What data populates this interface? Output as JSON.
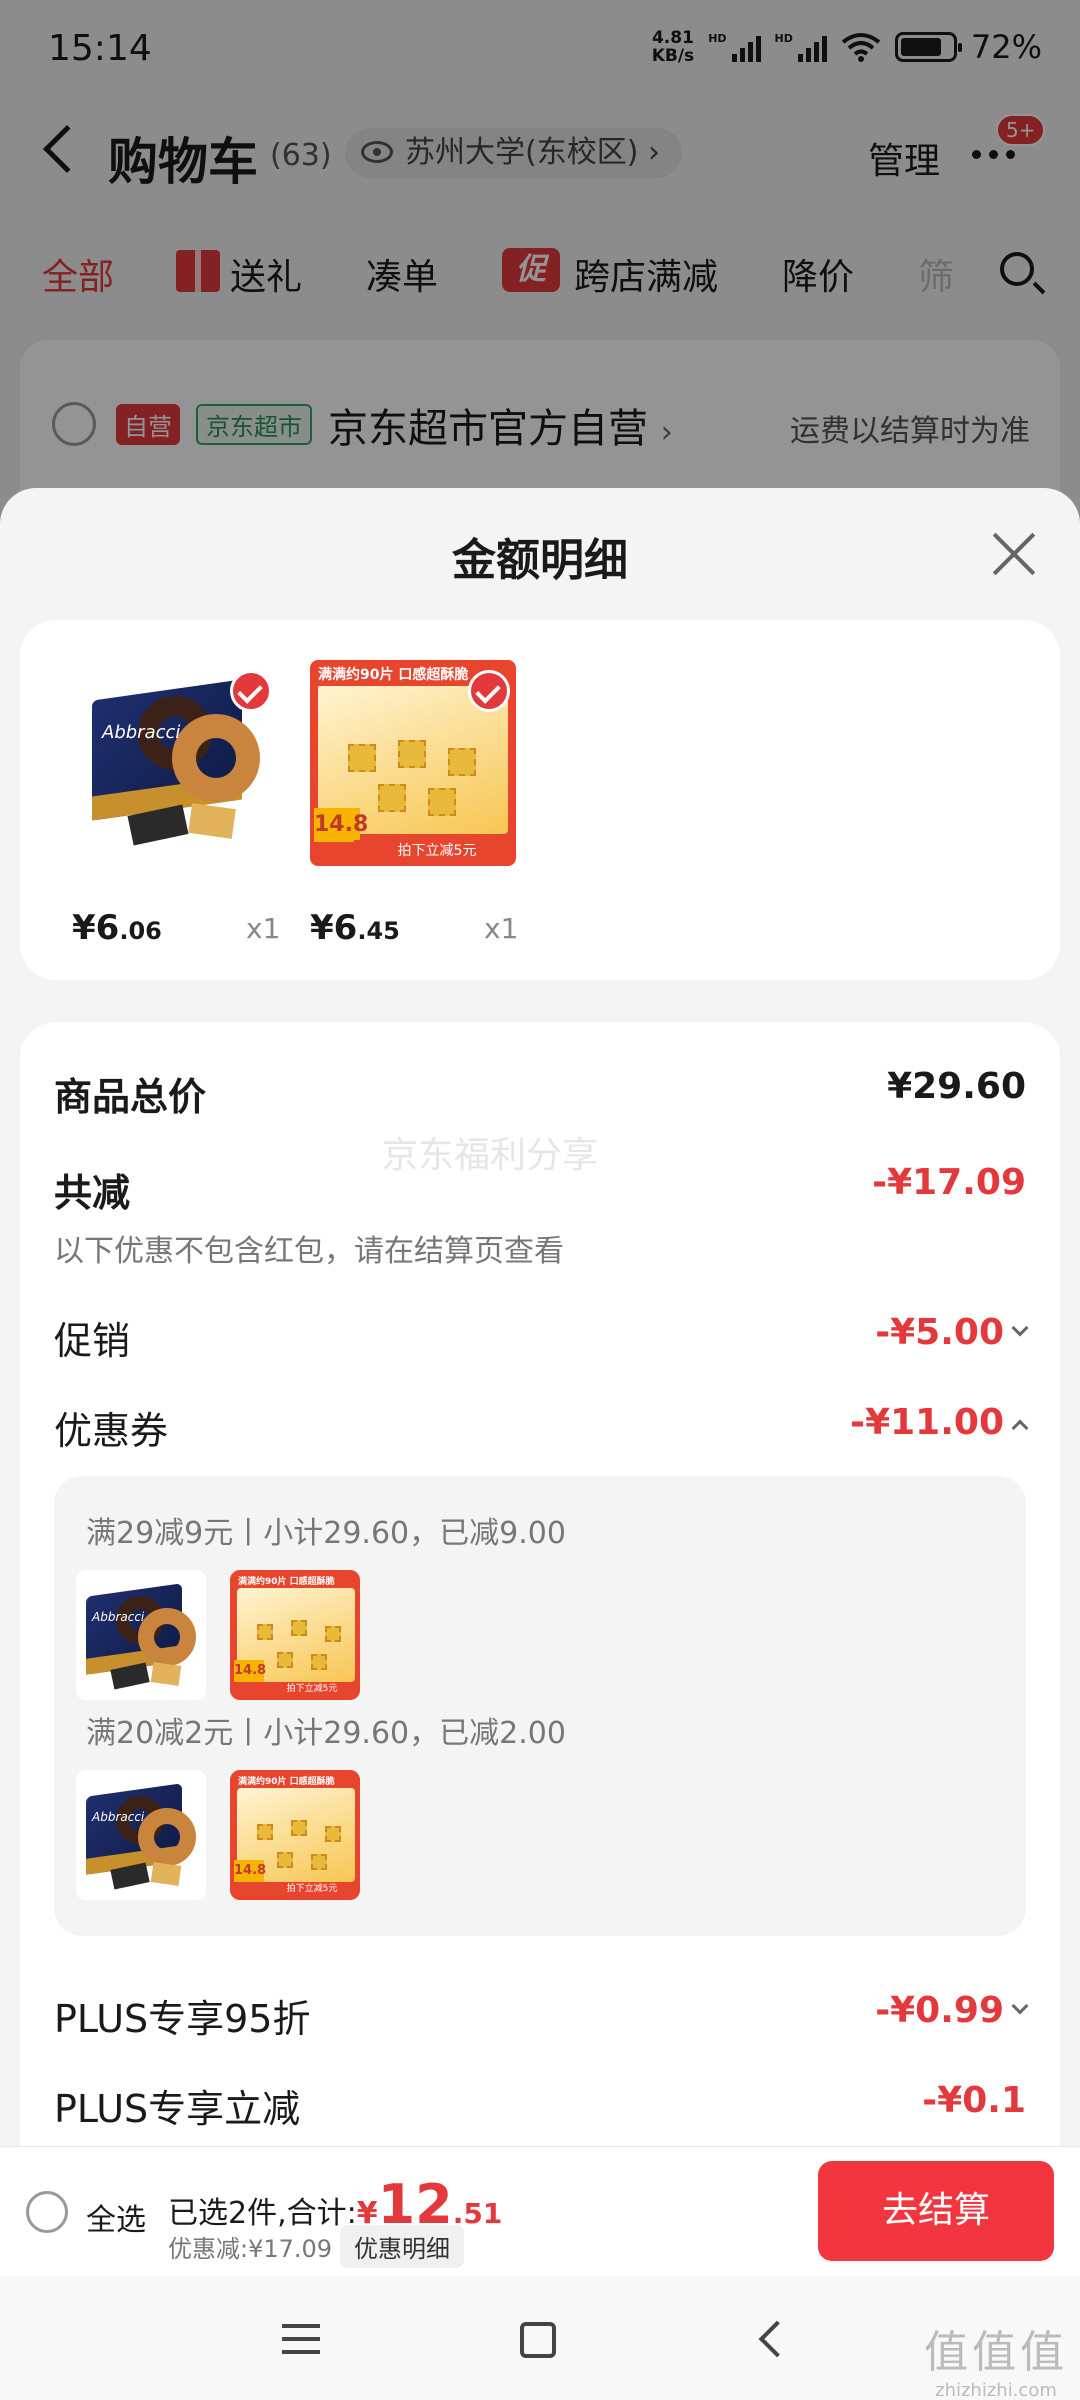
{
  "status_bar": {
    "time": "15:14",
    "net_speed_value": "4.81",
    "net_speed_unit": "KB/s",
    "signal_tag": "HD",
    "battery": "72%"
  },
  "header": {
    "title": "购物车",
    "count": "(63)",
    "location": "苏州大学(东校区)",
    "location_chevron": "›",
    "manage": "管理",
    "badge": "5+"
  },
  "tabs": {
    "all": "全部",
    "gift": "送礼",
    "bundle": "凑单",
    "promo_icon": "促",
    "cross_store": "跨店满减",
    "price_drop": "降价",
    "more": "筛"
  },
  "store": {
    "tag_self": "自营",
    "tag_market": "京东超市",
    "name": "京东超市官方自营",
    "chevron": "›",
    "shipping_note": "运费以结算时为准"
  },
  "sheet": {
    "title": "金额明细",
    "products": [
      {
        "currency": "¥",
        "price_int": "6",
        "price_dec": ".06",
        "qty": "x1"
      },
      {
        "currency": "¥",
        "price_int": "6",
        "price_dec": ".45",
        "qty": "x1"
      }
    ],
    "product_art": {
      "donut_brand": "Abbracci",
      "cracker_header": "满满约90片 口感超酥脆",
      "cracker_price": "14.8",
      "cracker_footer": "拍下立减5元"
    },
    "watermark": "京东福利分享",
    "total_label": "商品总价",
    "total_value": "¥29.60",
    "discount_label": "共减",
    "discount_value": "-¥17.09",
    "discount_note": "以下优惠不包含红包，请在结算页查看",
    "promo_label": "促销",
    "promo_value": "-¥5.00",
    "coupon_label": "优惠券",
    "coupon_value": "-¥11.00",
    "coupons": [
      {
        "text": "满29减9元丨小计29.60，已减9.00"
      },
      {
        "text": "满20减2元丨小计29.60，已减2.00"
      }
    ],
    "plus_discount_label": "PLUS专享95折",
    "plus_discount_value": "-¥0.99",
    "plus_cut_label": "PLUS专享立减",
    "plus_cut_value": "-¥0.1"
  },
  "bottom_bar": {
    "select_all": "全选",
    "selected_text": "已选2件,合计:",
    "total_currency": "¥",
    "total_int": "12",
    "total_dec": ".51",
    "discount_text": "优惠减:¥17.09",
    "detail_button": "优惠明细",
    "checkout": "去结算"
  },
  "watermark_site": {
    "big": "值值值",
    "small": "zhizhizhi.com"
  }
}
